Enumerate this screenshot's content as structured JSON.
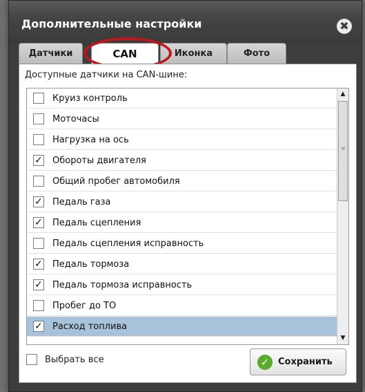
{
  "dialog": {
    "title": "Дополнительные настройки",
    "close_glyph": "✖",
    "tabs": [
      {
        "label": "Датчики",
        "active": false
      },
      {
        "label": "CAN",
        "active": true
      },
      {
        "label": "Иконка",
        "active": false
      },
      {
        "label": "Фото",
        "active": false
      }
    ],
    "section_label": "Доступные датчики на CAN-шине:",
    "sensors": [
      {
        "label": "Круиз контроль",
        "checked": false,
        "selected": false
      },
      {
        "label": "Моточасы",
        "checked": false,
        "selected": false
      },
      {
        "label": "Нагрузка на ось",
        "checked": false,
        "selected": false
      },
      {
        "label": "Обороты двигателя",
        "checked": true,
        "selected": false
      },
      {
        "label": "Общий пробег автомобиля",
        "checked": false,
        "selected": false
      },
      {
        "label": "Педаль газа",
        "checked": true,
        "selected": false
      },
      {
        "label": "Педаль сцепления",
        "checked": true,
        "selected": false
      },
      {
        "label": "Педаль сцепления исправность",
        "checked": false,
        "selected": false
      },
      {
        "label": "Педаль тормоза",
        "checked": true,
        "selected": false
      },
      {
        "label": "Педаль тормоза исправность",
        "checked": true,
        "selected": false
      },
      {
        "label": "Пробег до ТО",
        "checked": false,
        "selected": false
      },
      {
        "label": "Расход топлива",
        "checked": true,
        "selected": true
      }
    ],
    "select_all_label": "Выбрать все",
    "select_all_checked": false,
    "save_label": "Сохранить",
    "colors": {
      "selected_row": "#a8c2da",
      "highlight_ring": "#c0161d",
      "save_icon": "#5aaa2c"
    }
  }
}
